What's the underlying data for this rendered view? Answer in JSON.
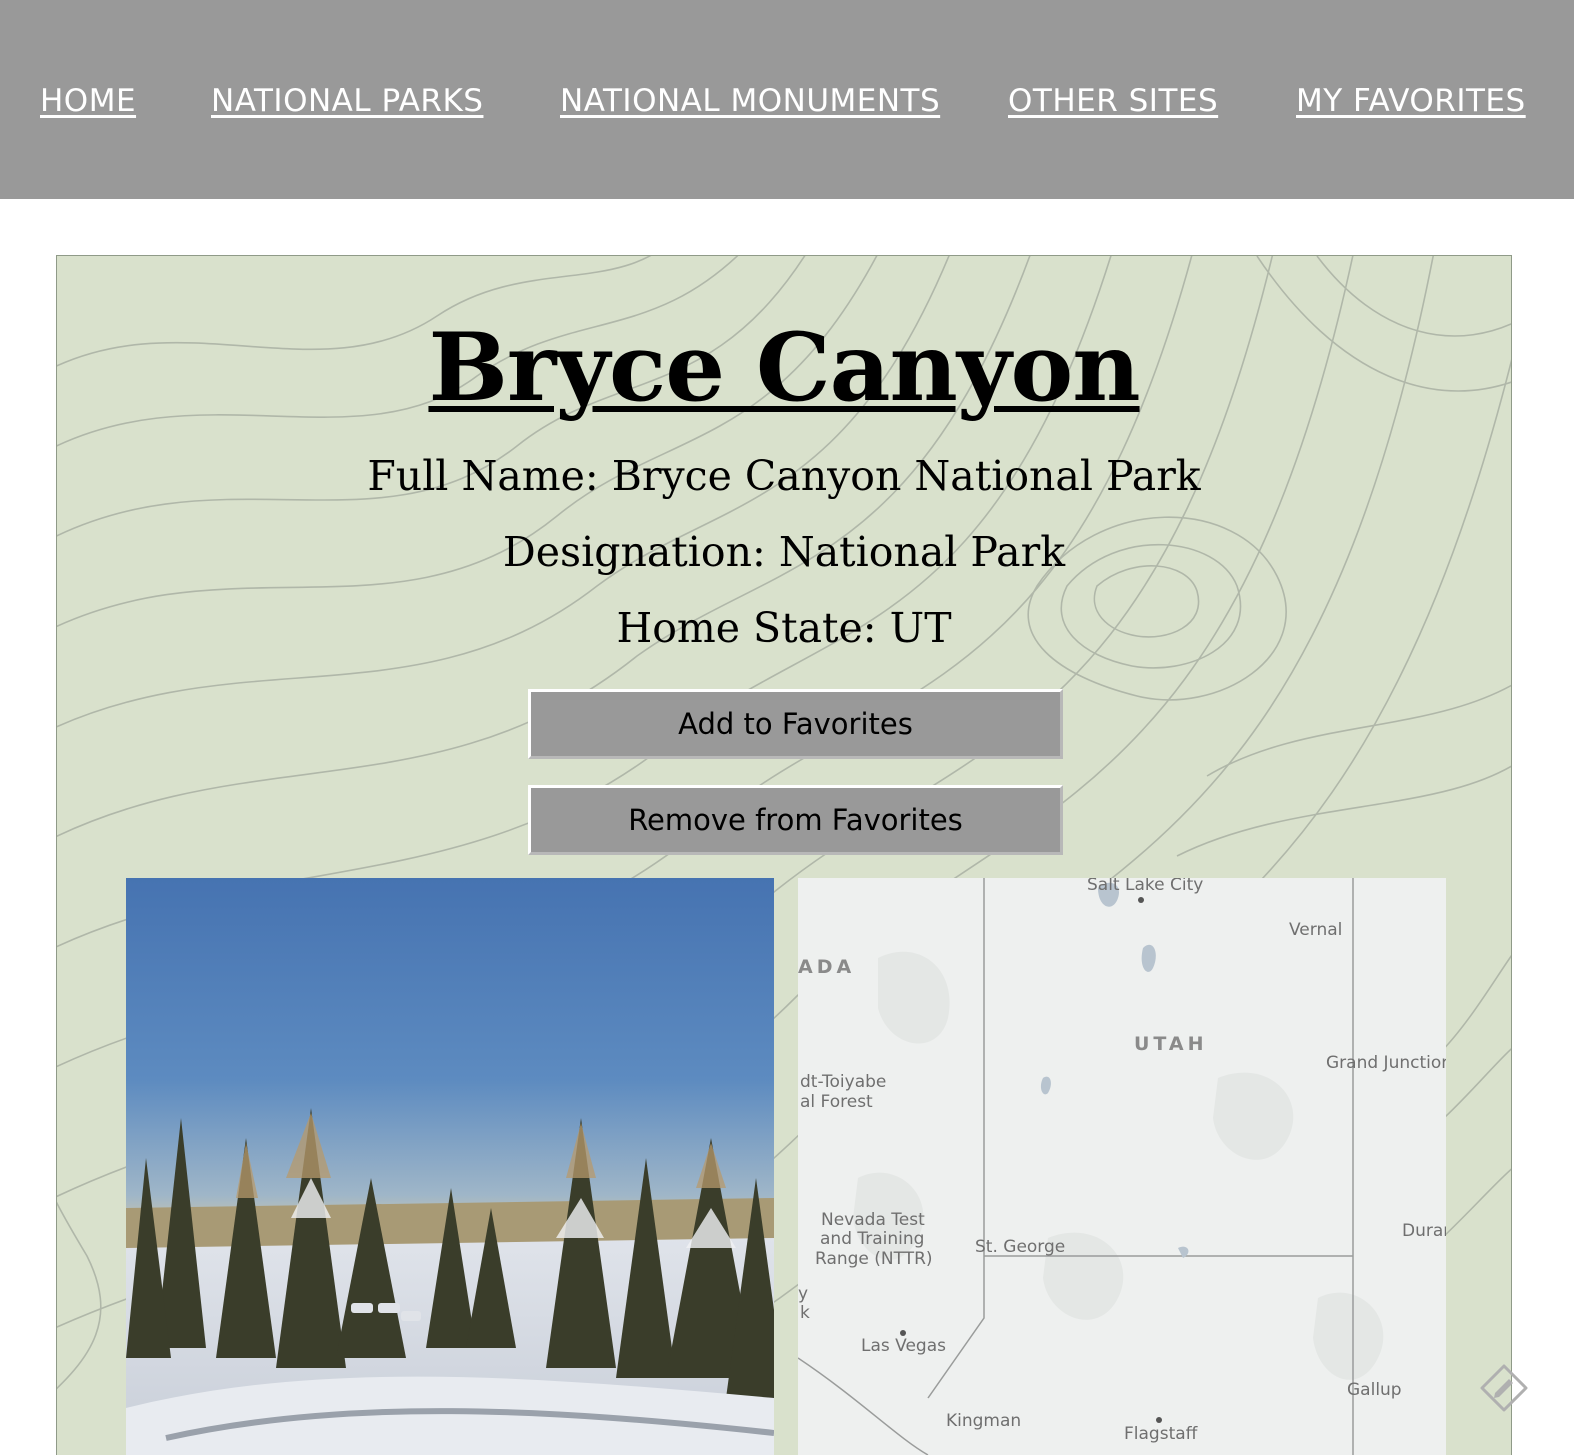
{
  "nav": {
    "items": [
      {
        "label": "HOME"
      },
      {
        "label": "NATIONAL PARKS"
      },
      {
        "label": "NATIONAL MONUMENTS"
      },
      {
        "label": "OTHER SITES"
      },
      {
        "label": "MY FAVORITES"
      }
    ]
  },
  "park": {
    "title": "Bryce Canyon",
    "full_name": "Full Name: Bryce Canyon National Park",
    "designation": "Designation: National Park",
    "home_state": "Home State: UT"
  },
  "actions": {
    "add_label": "Add to Favorites",
    "remove_label": "Remove from Favorites"
  },
  "map": {
    "labels": [
      "Salt Lake City",
      "Vernal",
      "ADA",
      "UTAH",
      "Grand Junctior",
      "dt-Toiyabe",
      "al Forest",
      "Nevada Test",
      "and Training",
      "Range (NTTR)",
      "St. George",
      "Durar",
      "y",
      "k",
      "Las Vegas",
      "Gallup",
      "Kingman",
      "Flagstaff"
    ]
  },
  "colors": {
    "nav_bg": "#999999",
    "card_bg": "#d9e1cc",
    "button_bg": "#999999"
  },
  "icons": {
    "map_edit": "edit-icon"
  }
}
